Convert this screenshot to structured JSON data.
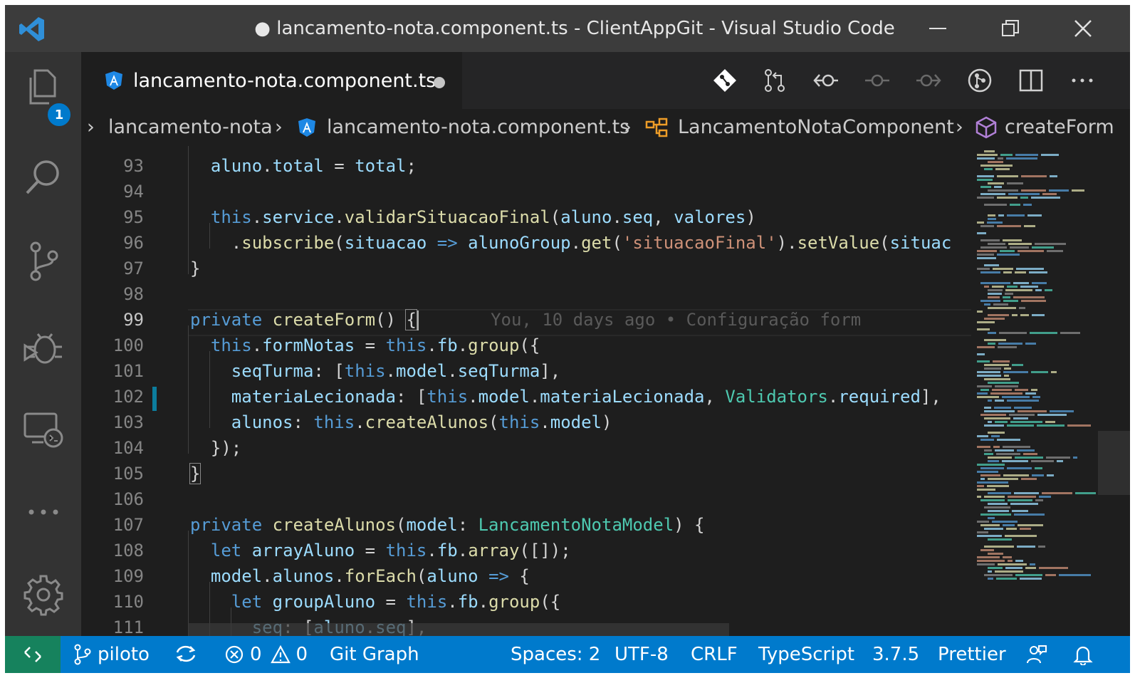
{
  "window": {
    "title": "● lancamento-nota.component.ts - ClientAppGit - Visual Studio Code"
  },
  "activity_bar": {
    "explorer_badge": "1",
    "items": [
      "explorer-icon",
      "search-icon",
      "source-control-icon",
      "debug-icon",
      "remote-explorer-icon",
      "more-icon",
      "settings-gear-icon"
    ]
  },
  "tab": {
    "label": "lancamento-nota.component.ts"
  },
  "breadcrumbs": {
    "folder": "lancamento-nota",
    "file": "lancamento-nota.component.ts",
    "class": "LancamentoNotaComponent",
    "method": "createForm"
  },
  "editor": {
    "lines": [
      "93",
      "94",
      "95",
      "96",
      "97",
      "98",
      "99",
      "100",
      "101",
      "102",
      "103",
      "104",
      "105",
      "106",
      "107",
      "108",
      "109",
      "110",
      "111"
    ],
    "code": {
      "l93_a": "aluno",
      "l93_b": ".",
      "l93_c": "total",
      "l93_d": " = ",
      "l93_e": "total",
      "l93_f": ";",
      "l95_a": "this",
      "l95_b": ".",
      "l95_c": "service",
      "l95_d": ".",
      "l95_e": "validarSituacaoFinal",
      "l95_f": "(",
      "l95_g": "aluno",
      "l95_h": ".",
      "l95_i": "seq",
      "l95_j": ", ",
      "l95_k": "valores",
      "l95_l": ")",
      "l96_a": ".",
      "l96_b": "subscribe",
      "l96_c": "(",
      "l96_d": "situacao",
      "l96_e": " => ",
      "l96_f": "alunoGroup",
      "l96_g": ".",
      "l96_h": "get",
      "l96_i": "(",
      "l96_j": "'situacaoFinal'",
      "l96_k": ").",
      "l96_l": "setValue",
      "l96_m": "(",
      "l96_n": "situac",
      "l97": "}",
      "l99_a": "private",
      "l99_b": " ",
      "l99_c": "createForm",
      "l99_d": "() ",
      "l99_e": "{",
      "l99_blame": "You, 10 days ago • Configuração form",
      "l100_a": "this",
      "l100_b": ".",
      "l100_c": "formNotas",
      "l100_d": " = ",
      "l100_e": "this",
      "l100_f": ".",
      "l100_g": "fb",
      "l100_h": ".",
      "l100_i": "group",
      "l100_j": "({",
      "l101_a": "seqTurma",
      "l101_b": ": [",
      "l101_c": "this",
      "l101_d": ".",
      "l101_e": "model",
      "l101_f": ".",
      "l101_g": "seqTurma",
      "l101_h": "],",
      "l102_a": "materiaLecionada",
      "l102_b": ": [",
      "l102_c": "this",
      "l102_d": ".",
      "l102_e": "model",
      "l102_f": ".",
      "l102_g": "materiaLecionada",
      "l102_h": ", ",
      "l102_i": "Validators",
      "l102_j": ".",
      "l102_k": "required",
      "l102_l": "],",
      "l103_a": "alunos",
      "l103_b": ": ",
      "l103_c": "this",
      "l103_d": ".",
      "l103_e": "createAlunos",
      "l103_f": "(",
      "l103_g": "this",
      "l103_h": ".",
      "l103_i": "model",
      "l103_j": ")",
      "l104": "});",
      "l105": "}",
      "l107_a": "private",
      "l107_b": " ",
      "l107_c": "createAlunos",
      "l107_d": "(",
      "l107_e": "model",
      "l107_f": ": ",
      "l107_g": "LancamentoNotaModel",
      "l107_h": ") {",
      "l108_a": "let",
      "l108_b": " ",
      "l108_c": "arrayAluno",
      "l108_d": " = ",
      "l108_e": "this",
      "l108_f": ".",
      "l108_g": "fb",
      "l108_h": ".",
      "l108_i": "array",
      "l108_j": "([]);",
      "l109_a": "model",
      "l109_b": ".",
      "l109_c": "alunos",
      "l109_d": ".",
      "l109_e": "forEach",
      "l109_f": "(",
      "l109_g": "aluno",
      "l109_h": " => ",
      "l109_i": "{",
      "l110_a": "let",
      "l110_b": " ",
      "l110_c": "groupAluno",
      "l110_d": " = ",
      "l110_e": "this",
      "l110_f": ".",
      "l110_g": "fb",
      "l110_h": ".",
      "l110_i": "group",
      "l110_j": "({",
      "l111_a": "seq",
      "l111_b": ": [",
      "l111_c": "aluno",
      "l111_d": ".",
      "l111_e": "seq",
      "l111_f": "],"
    }
  },
  "status_bar": {
    "branch": "piloto",
    "errors": "0",
    "warnings": "0",
    "git_graph": "Git Graph",
    "spaces": "Spaces: 2",
    "encoding": "UTF-8",
    "eol": "CRLF",
    "language": "TypeScript",
    "version": "3.7.5",
    "formatter": "Prettier"
  },
  "colors": {
    "accent": "#007acc",
    "remote": "#16825d",
    "editor_bg": "#1e1e1e",
    "angular_icon": "#1e88e5"
  }
}
